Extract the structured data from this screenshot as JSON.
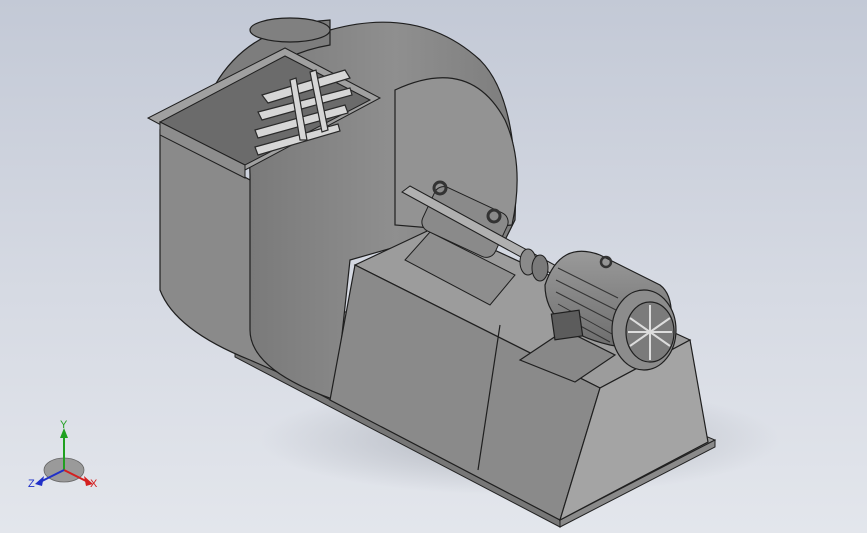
{
  "viewport": {
    "background_top": "#c3c9d6",
    "background_bottom": "#e3e6ec"
  },
  "model": {
    "description_hidden": false,
    "body_color": "#8c8c8c",
    "edge_color": "#1f1f1f"
  },
  "triad": {
    "x_label": "X",
    "y_label": "Y",
    "z_label": "Z",
    "x_color": "#d42020",
    "y_color": "#20a020",
    "z_color": "#2030c8"
  }
}
